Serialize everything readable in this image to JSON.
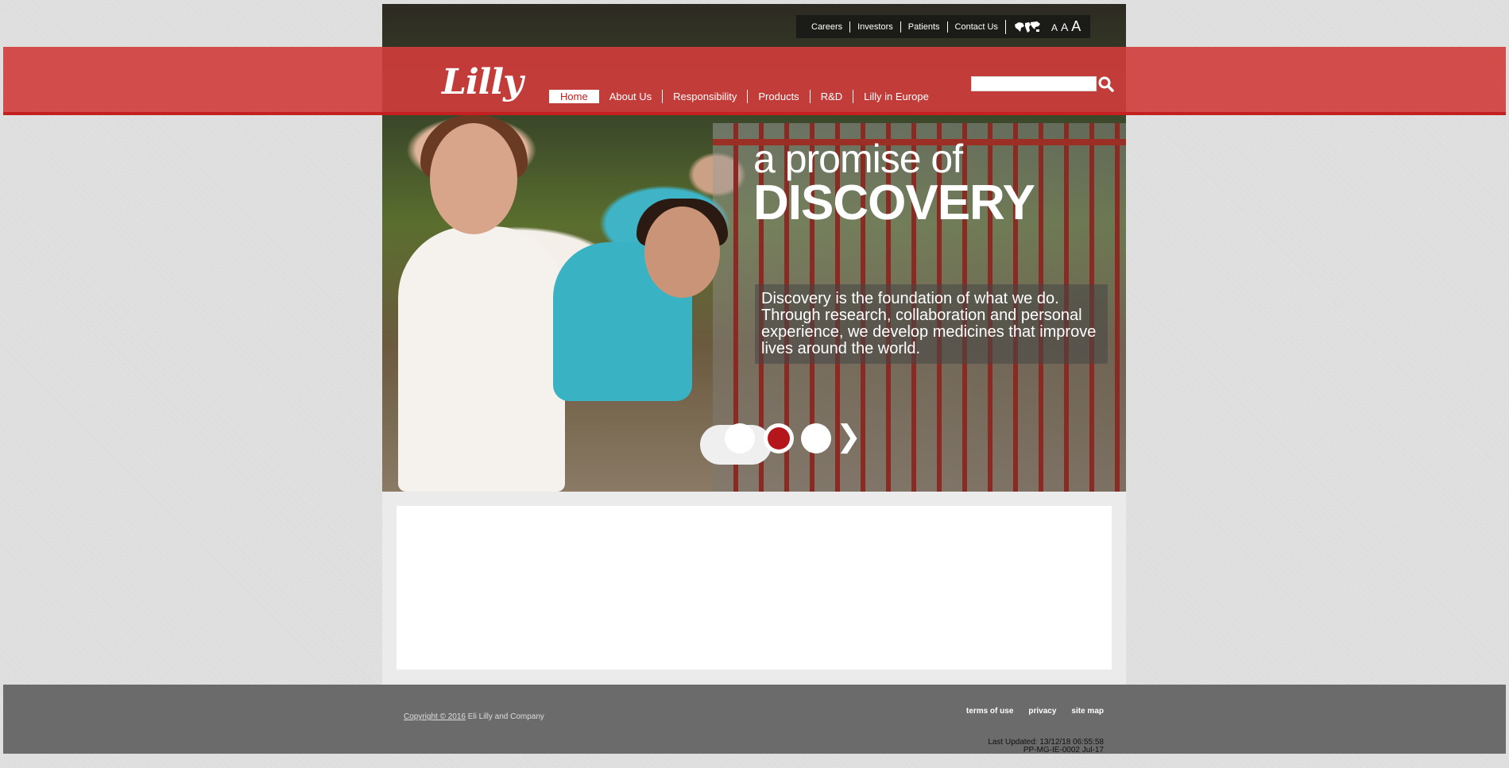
{
  "utility": {
    "links": [
      "Careers",
      "Investors",
      "Patients",
      "Contact Us"
    ],
    "globe_icon": "world-map-icon",
    "text_sizes": [
      "A",
      "A",
      "A"
    ]
  },
  "header": {
    "logo": "Lilly",
    "nav": [
      "Home",
      "About Us",
      "Responsibility",
      "Products",
      "R&D",
      "Lilly in Europe"
    ],
    "active_nav": "Home",
    "search": {
      "value": "",
      "icon": "search-icon"
    },
    "brand_color": "#c32020"
  },
  "hero": {
    "headline_line1": "a promise of",
    "headline_line2": "DISCOVERY",
    "caption": "Discovery is the foundation of what we do. Through research, collaboration and personal experience, we develop medicines that improve lives around the world.",
    "slides": 3,
    "active_slide": 2,
    "next_icon": "chevron-right-icon"
  },
  "footer": {
    "copyright_link": "Copyright © 2016",
    "copyright_text": " Eli Lilly and Company",
    "links": [
      "terms of use",
      "privacy",
      "site map"
    ],
    "last_updated": "Last Updated: 13/12/18 06:55:58",
    "code": "PP-MG-IE-0002 Jul-17"
  }
}
